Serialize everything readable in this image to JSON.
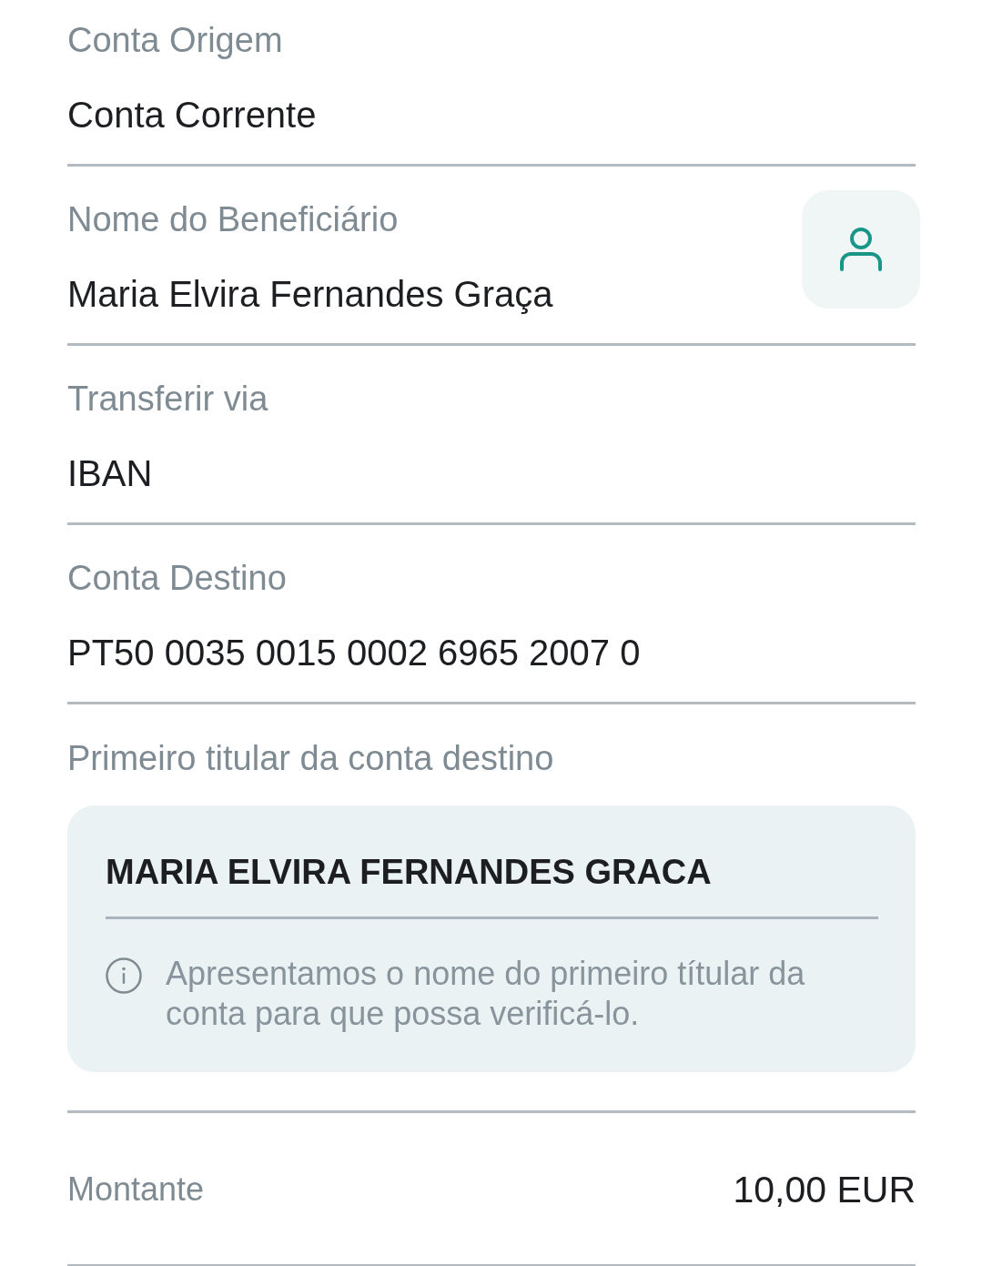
{
  "fields": [
    {
      "kind": "plain",
      "label": "Conta Origem",
      "value": "Conta Corrente"
    },
    {
      "kind": "contact",
      "label": "Nome do Beneficiário",
      "value": "Maria Elvira Fernandes Graça"
    },
    {
      "kind": "plain",
      "label": "Transferir via",
      "value": "IBAN"
    },
    {
      "kind": "plain",
      "label": "Conta Destino",
      "value": "PT50 0035 0015 0002 6965 2007 0"
    }
  ],
  "account_holder": {
    "label": "Primeiro titular da conta destino",
    "name": "MARIA ELVIRA FERNANDES GRACA",
    "info": "Apresentamos o nome do primeiro títular da conta para que possa verificá-lo."
  },
  "amount": {
    "label": "Montante",
    "value": "10,00 EUR"
  }
}
